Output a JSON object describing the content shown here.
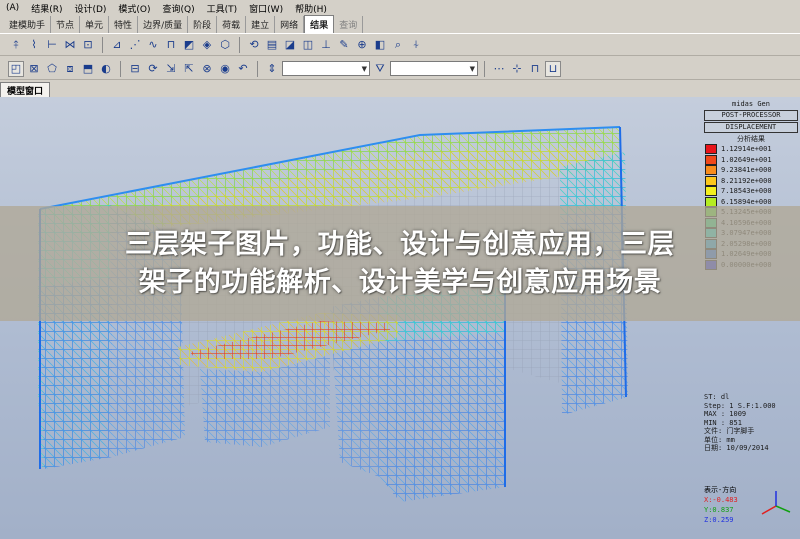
{
  "menu": {
    "items": [
      "(A)",
      "结果(R)",
      "设计(D)",
      "模式(O)",
      "查询(Q)",
      "工具(T)",
      "窗口(W)",
      "帮助(H)"
    ]
  },
  "tabs": {
    "items": [
      {
        "label": "建模助手",
        "state": "normal"
      },
      {
        "label": "节点",
        "state": "normal"
      },
      {
        "label": "单元",
        "state": "normal"
      },
      {
        "label": "特性",
        "state": "normal"
      },
      {
        "label": "边界/质量",
        "state": "normal"
      },
      {
        "label": "阶段",
        "state": "normal"
      },
      {
        "label": "荷载",
        "state": "normal"
      },
      {
        "label": "建立",
        "state": "normal"
      },
      {
        "label": "网络",
        "state": "normal"
      },
      {
        "label": "结果",
        "state": "active"
      },
      {
        "label": "查询",
        "state": "dim"
      }
    ]
  },
  "toolbar": {
    "combo1_value": "",
    "combo2_value": ""
  },
  "window": {
    "title": "模型窗口"
  },
  "legend": {
    "header1": "midas Gen",
    "header2": "POST-PROCESSOR",
    "box_label": "DISPLACEMENT",
    "subtitle": "分析结果",
    "entries": [
      {
        "value": "1.12914e+001",
        "color": "#e8141a"
      },
      {
        "value": "1.02649e+001",
        "color": "#f0481a"
      },
      {
        "value": "9.23841e+000",
        "color": "#f88c1c"
      },
      {
        "value": "8.21192e+000",
        "color": "#fcc81c"
      },
      {
        "value": "7.18543e+000",
        "color": "#f4f01e"
      },
      {
        "value": "6.15894e+000",
        "color": "#b4ec22"
      },
      {
        "value": "5.13245e+000",
        "color": "#5ee032"
      },
      {
        "value": "4.10596e+000",
        "color": "#2cdc8a"
      },
      {
        "value": "3.07947e+000",
        "color": "#22d8d4"
      },
      {
        "value": "2.05298e+000",
        "color": "#1ea8ec"
      },
      {
        "value": "1.02649e+000",
        "color": "#1e6cf0"
      },
      {
        "value": "0.00000e+000",
        "color": "#1e2ce8"
      }
    ]
  },
  "info": {
    "lines": [
      "ST: dl",
      "Step: 1 S.F:1.000",
      "MAX : 1009",
      "MIN : 851",
      "文件: 门字脚手",
      "单位: mm",
      "日期: 10/09/2014"
    ]
  },
  "axis": {
    "label": "表示-方向",
    "x": "X:-0.483",
    "y": "Y:0.837",
    "z": "Z:0.259"
  },
  "banner": {
    "line1": "三层架子图片，功能、设计与创意应用，三层",
    "line2": "架子的功能解析、设计美学与创意应用场景"
  }
}
